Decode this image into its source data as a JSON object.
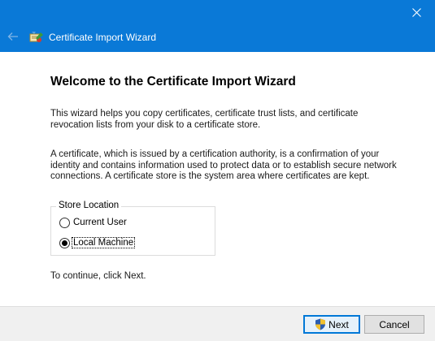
{
  "window": {
    "title": "Certificate Import Wizard",
    "accent_color": "#0a79d7"
  },
  "icons": {
    "close": "close-icon",
    "back": "back-arrow-icon",
    "wizard": "certificate-icon",
    "uac": "uac-shield-icon"
  },
  "content": {
    "heading": "Welcome to the Certificate Import Wizard",
    "paragraph1": "This wizard helps you copy certificates, certificate trust lists, and certificate revocation lists from your disk to a certificate store.",
    "paragraph2": "A certificate, which is issued by a certification authority, is a confirmation of your identity and contains information used to protect data or to establish secure network connections. A certificate store is the system area where certificates are kept.",
    "store_location": {
      "legend": "Store Location",
      "options": [
        {
          "label": "Current User",
          "selected": false
        },
        {
          "label": "Local Machine",
          "selected": true
        }
      ]
    },
    "continue_text": "To continue, click Next."
  },
  "footer": {
    "next_label": "Next",
    "cancel_label": "Cancel"
  }
}
